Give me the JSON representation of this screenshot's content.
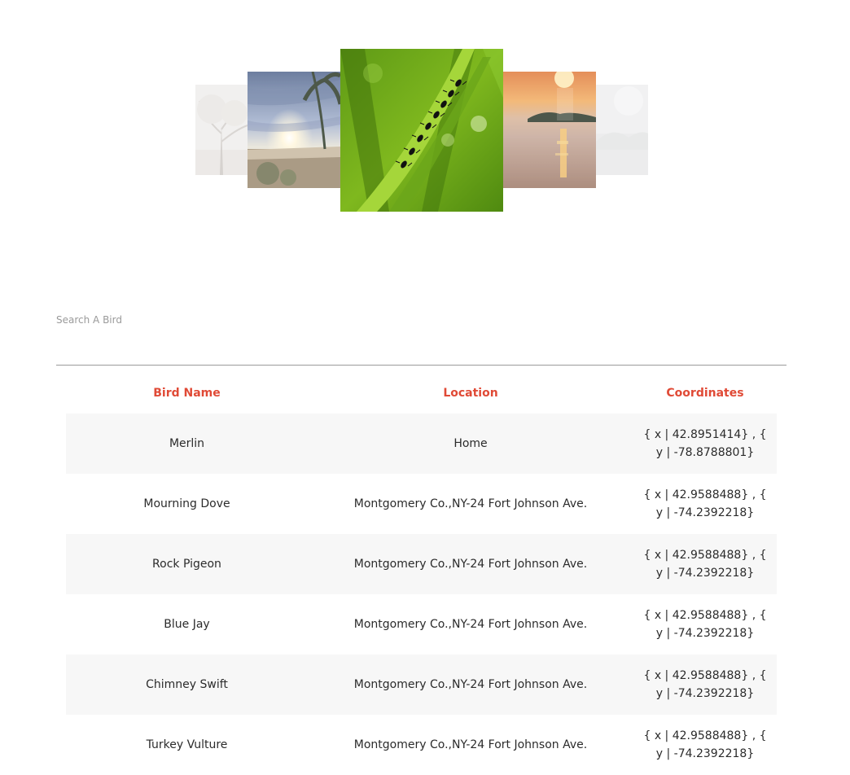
{
  "carousel": {
    "slides": [
      {
        "icon": "tree-photo"
      },
      {
        "icon": "beach-sunset-photo"
      },
      {
        "icon": "ants-on-grass-photo"
      },
      {
        "icon": "lake-sunset-photo"
      },
      {
        "icon": "foggy-photo"
      }
    ],
    "active_index": 2
  },
  "search": {
    "placeholder": "Search A Bird",
    "value": ""
  },
  "table": {
    "headers": {
      "name": "Bird Name",
      "location": "Location",
      "coordinates": "Coordinates"
    },
    "rows": [
      {
        "name": "Merlin",
        "location": "Home",
        "coordinates": "{ x | 42.8951414} , { y | -78.8788801}"
      },
      {
        "name": "Mourning Dove",
        "location": "Montgomery Co.,NY-24 Fort Johnson Ave.",
        "coordinates": "{ x | 42.9588488} , { y | -74.2392218}"
      },
      {
        "name": "Rock Pigeon",
        "location": "Montgomery Co.,NY-24 Fort Johnson Ave.",
        "coordinates": "{ x | 42.9588488} , { y | -74.2392218}"
      },
      {
        "name": "Blue Jay",
        "location": "Montgomery Co.,NY-24 Fort Johnson Ave.",
        "coordinates": "{ x | 42.9588488} , { y | -74.2392218}"
      },
      {
        "name": "Chimney Swift",
        "location": "Montgomery Co.,NY-24 Fort Johnson Ave.",
        "coordinates": "{ x | 42.9588488} , { y | -74.2392218}"
      },
      {
        "name": "Turkey Vulture",
        "location": "Montgomery Co.,NY-24 Fort Johnson Ave.",
        "coordinates": "{ x | 42.9588488} , { y | -74.2392218}"
      }
    ]
  },
  "colors": {
    "header_accent": "#e04a36",
    "row_alt": "#f7f7f7"
  }
}
